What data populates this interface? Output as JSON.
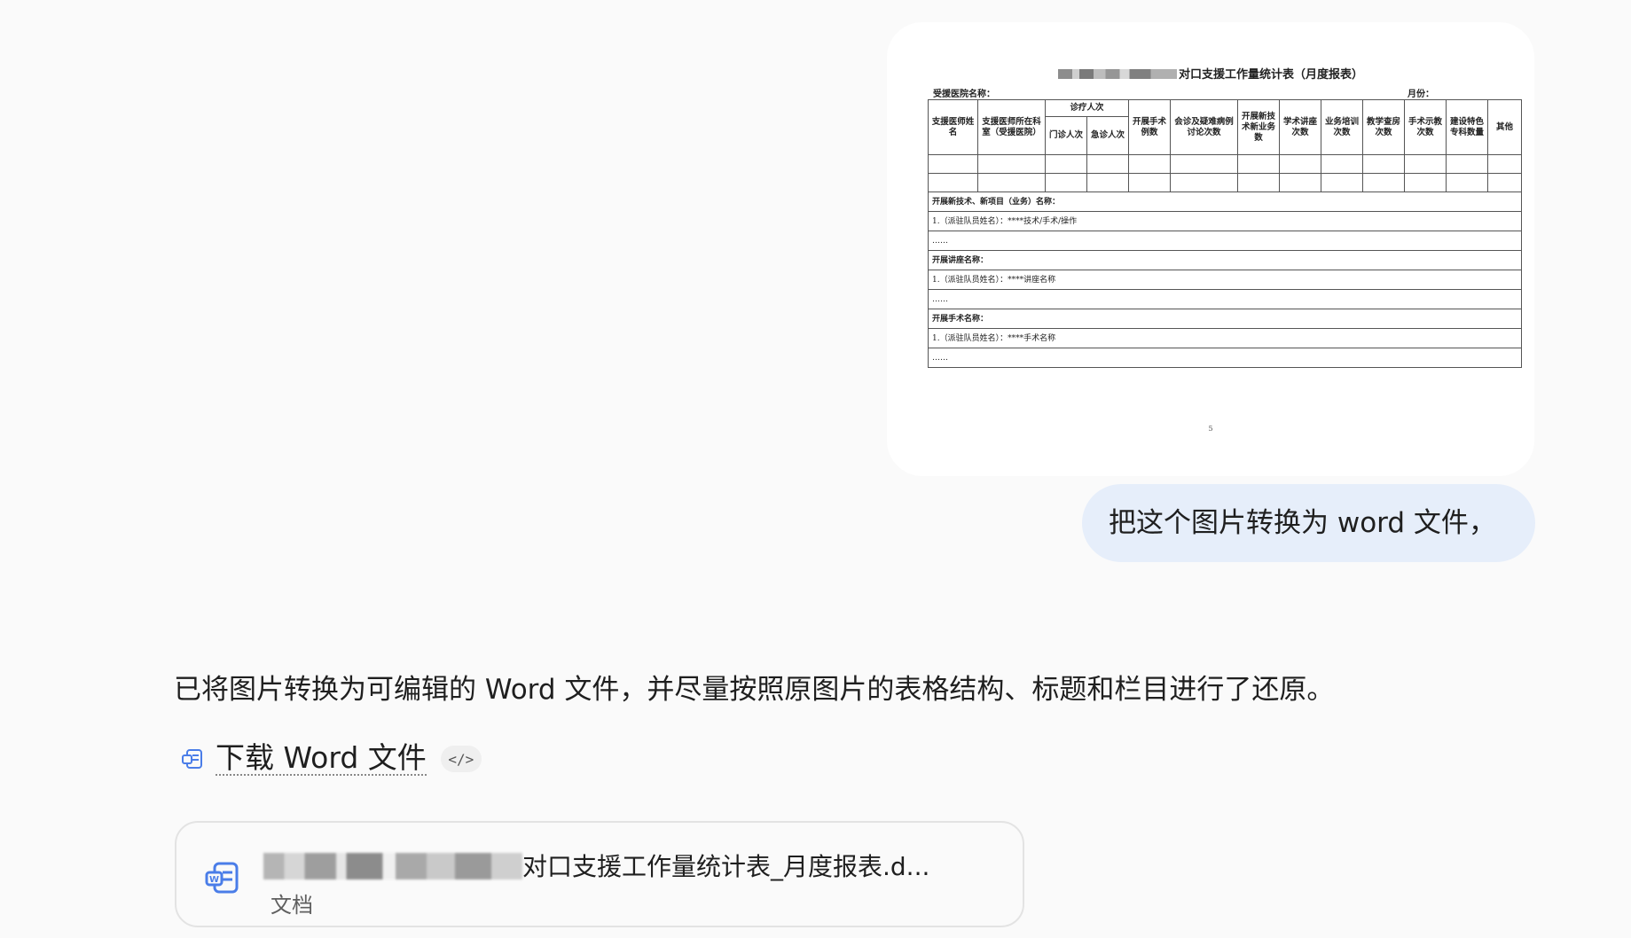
{
  "user_image": {
    "doc_title_suffix": "对口支援工作量统计表（月度报表）",
    "hospital_label": "受援医院名称：",
    "month_label": "月份：",
    "table": {
      "header_group": "诊疗人次",
      "headers": [
        "支援医师姓名",
        "支援医师所在科室（受援医院）",
        "门诊人次",
        "急诊人次",
        "开展手术例数",
        "会诊及疑难病例讨论次数",
        "开展新技术新业务数",
        "学术讲座次数",
        "业务培训次数",
        "教学查房次数",
        "手术示教次数",
        "建设特色专科数量",
        "其他"
      ],
      "sections": [
        {
          "title": "开展新技术、新项目（业务）名称：",
          "item": "1.（派驻队员姓名）：****技术/手术/操作",
          "more": "……"
        },
        {
          "title": "开展讲座名称：",
          "item": "1.（派驻队员姓名）：****讲座名称",
          "more": "……"
        },
        {
          "title": "开展手术名称：",
          "item": "1.（派驻队员姓名）：****手术名称",
          "more": "……"
        }
      ]
    },
    "page_number": "5"
  },
  "user_message": "把这个图片转换为 word 文件，",
  "assistant": {
    "reply": "已将图片转换为可编辑的 Word 文件，并尽量按照原图片的表格结构、标题和栏目进行了还原。",
    "download_label": "下载 Word 文件",
    "code_chip": "</>",
    "file_card": {
      "name_suffix": "对口支援工作量统计表_月度报表.d...",
      "type": "文档"
    }
  },
  "colors": {
    "background": "#fafafa",
    "user_bubble": "#e6eefa",
    "word_icon": "#4a7de8"
  }
}
